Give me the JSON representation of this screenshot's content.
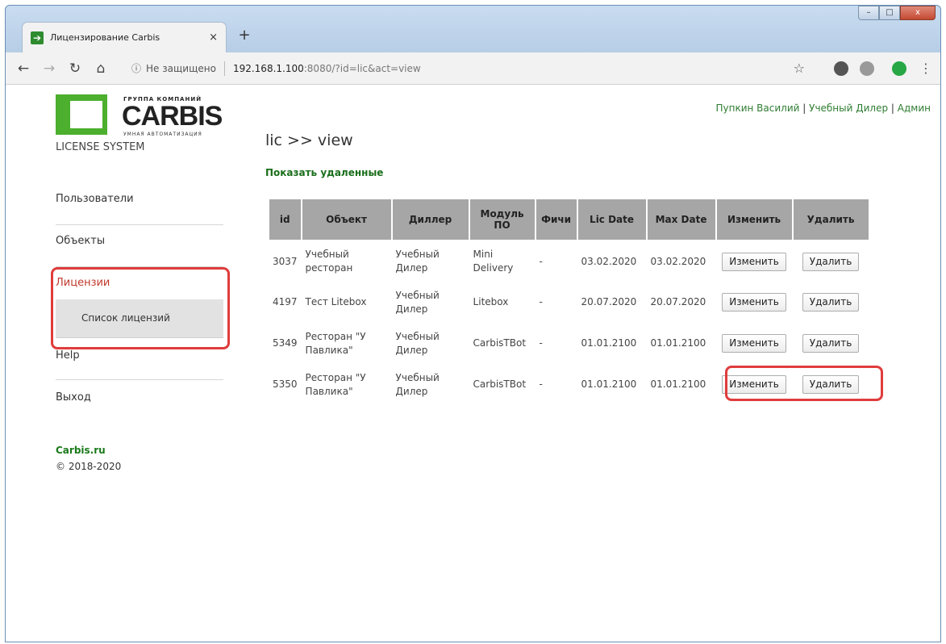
{
  "browser": {
    "tab_title": "Лицензирование Carbis",
    "tab_close": "×",
    "new_tab": "+",
    "security_label": "Не защищено",
    "url_host": "192.168.1.100",
    "url_rest": ":8080/?id=lic&act=view",
    "window_minimize": "–",
    "window_maximize": "□",
    "window_close": "x"
  },
  "logo": {
    "top_text": "ГРУППА КОМПАНИЙ",
    "name": "CARBIS",
    "sub_text": "УМНАЯ АВТОМАТИЗАЦИЯ",
    "system_label": "LICENSE SYSTEM"
  },
  "sidebar": {
    "items": [
      {
        "label": "Пользователи"
      },
      {
        "label": "Объекты"
      },
      {
        "label": "Лицензии"
      },
      {
        "label": "Список лицензий"
      },
      {
        "label": "Help"
      },
      {
        "label": "Выход"
      }
    ],
    "footer_link": "Carbis.ru",
    "copyright": "© 2018-2020"
  },
  "userbar": {
    "user": "Пупкин Василий",
    "separator": "|",
    "dealer": "Учебный Дилер",
    "role": "Админ"
  },
  "page": {
    "title": "lic >> view",
    "show_deleted": "Показать удаленные"
  },
  "table": {
    "headers": [
      "id",
      "Объект",
      "Диллер",
      "Модуль ПО",
      "Фичи",
      "Lic Date",
      "Max Date",
      "Изменить",
      "Удалить"
    ],
    "edit_label": "Изменить",
    "delete_label": "Удалить",
    "rows": [
      {
        "id": "3037",
        "object": "Учебный ресторан",
        "dealer": "Учебный Дилер",
        "module": "Mini Delivery",
        "features": "-",
        "lic_date": "03.02.2020",
        "max_date": "03.02.2020"
      },
      {
        "id": "4197",
        "object": "Тест Litebox",
        "dealer": "Учебный Дилер",
        "module": "Litebox",
        "features": "-",
        "lic_date": "20.07.2020",
        "max_date": "20.07.2020"
      },
      {
        "id": "5349",
        "object": "Ресторан \"У Павлика\"",
        "dealer": "Учебный Дилер",
        "module": "CarbisTBot",
        "features": "-",
        "lic_date": "01.01.2100",
        "max_date": "01.01.2100"
      },
      {
        "id": "5350",
        "object": "Ресторан \"У Павлика\"",
        "dealer": "Учебный Дилер",
        "module": "CarbisTBot",
        "features": "-",
        "lic_date": "01.01.2100",
        "max_date": "01.01.2100"
      }
    ]
  }
}
